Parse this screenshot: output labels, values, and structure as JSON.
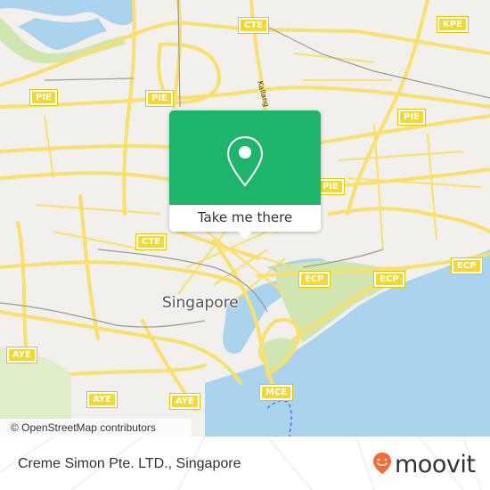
{
  "map": {
    "city_label": "Singapore",
    "street_label": "Kallang",
    "highway_shields": [
      {
        "label": "CTE"
      },
      {
        "label": "KPE"
      },
      {
        "label": "PIE"
      },
      {
        "label": "PIE"
      },
      {
        "label": "PIE"
      },
      {
        "label": "PIE"
      },
      {
        "label": "CTE"
      },
      {
        "label": "ECP"
      },
      {
        "label": "ECP"
      },
      {
        "label": "ECP"
      },
      {
        "label": "AYE"
      },
      {
        "label": "AYE"
      },
      {
        "label": "AYE"
      },
      {
        "label": "MCE"
      }
    ],
    "attribution": "© OpenStreetMap contributors",
    "colors": {
      "land": "#f2f0ec",
      "water": "#aad3ee",
      "park": "#cfe6b0",
      "road": "#f7e16a",
      "popup_green": "#1fb46b"
    }
  },
  "popup": {
    "pin_icon": "map-pin-icon",
    "button_label": "Take me there"
  },
  "footer": {
    "place_name": "Creme Simon Pte. LTD., Singapore",
    "brand_name": "moovit",
    "brand_color": "#f26b3a"
  }
}
